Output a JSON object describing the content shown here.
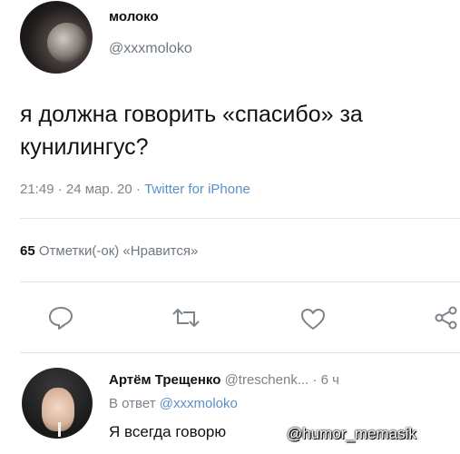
{
  "tweet": {
    "display_name": "молоко",
    "handle": "@xxxmoloko",
    "text": "я должна говорить «спасибо» за кунилингус?",
    "time": "21:49 · 24 мар. 20 ·",
    "source": "Twitter for iPhone",
    "likes_count": "65",
    "likes_label": "Отметки(-ок) «Нравится»"
  },
  "actions": [
    "reply-icon",
    "retweet-icon",
    "like-icon",
    "share-icon"
  ],
  "reply": {
    "display_name": "Артём Трещенко",
    "handle": "@treschenk...",
    "age": "· 6 ч",
    "in_reply_prefix": "В ответ",
    "in_reply_mention": "@xxxmoloko",
    "text": "Я всегда говорю"
  },
  "watermark": "@humor_memasik",
  "colors": {
    "link": "#5a8fc8",
    "muted": "#7b838b",
    "text": "#111111"
  }
}
